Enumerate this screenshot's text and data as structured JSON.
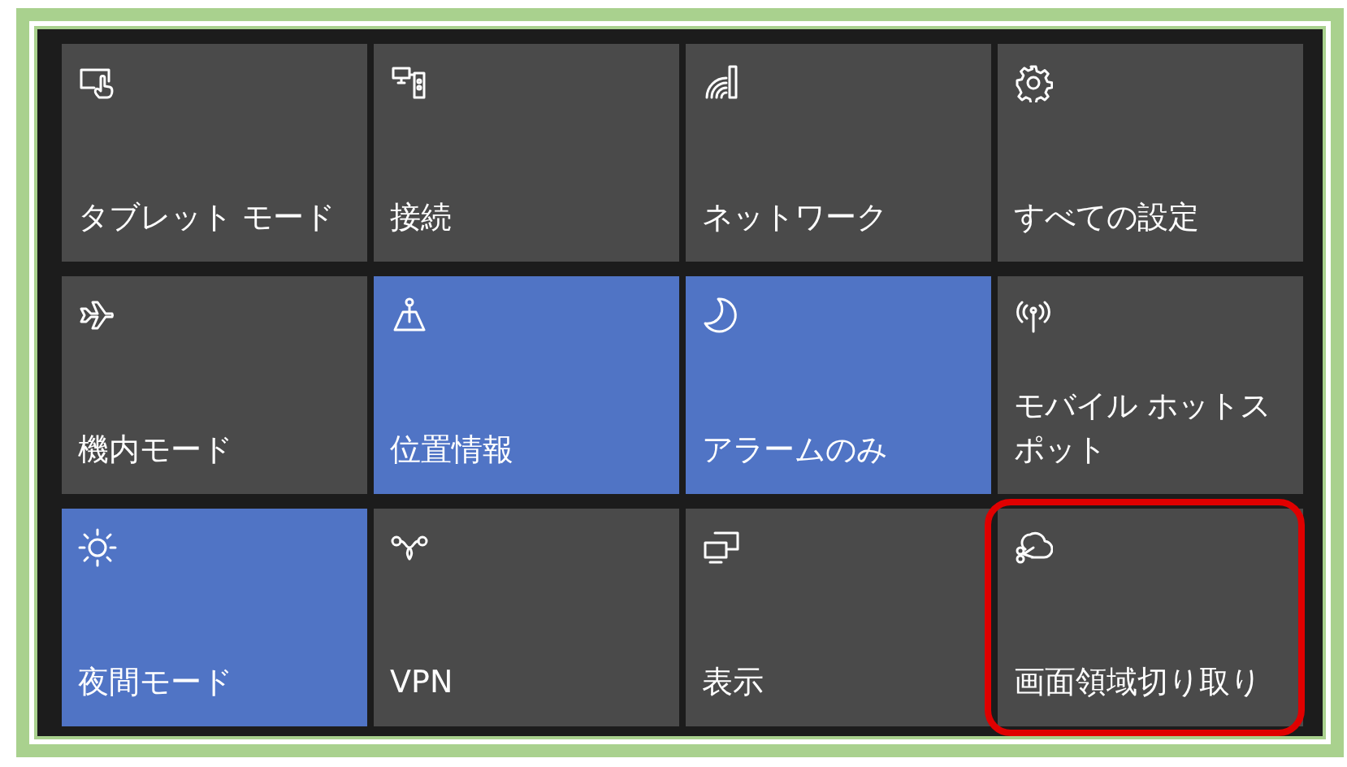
{
  "tiles": [
    {
      "label": "タブレット モード",
      "on": false,
      "highlighted": false
    },
    {
      "label": "接続",
      "on": false,
      "highlighted": false
    },
    {
      "label": "ネットワーク",
      "on": false,
      "highlighted": false
    },
    {
      "label": "すべての設定",
      "on": false,
      "highlighted": false
    },
    {
      "label": "機内モード",
      "on": false,
      "highlighted": false
    },
    {
      "label": "位置情報",
      "on": true,
      "highlighted": false
    },
    {
      "label": "アラームのみ",
      "on": true,
      "highlighted": false
    },
    {
      "label": "モバイル ホットスポット",
      "on": false,
      "highlighted": false
    },
    {
      "label": "夜間モード",
      "on": true,
      "highlighted": false
    },
    {
      "label": "VPN",
      "on": false,
      "highlighted": false
    },
    {
      "label": "表示",
      "on": false,
      "highlighted": false
    },
    {
      "label": "画面領域切り取り",
      "on": false,
      "highlighted": true
    }
  ]
}
